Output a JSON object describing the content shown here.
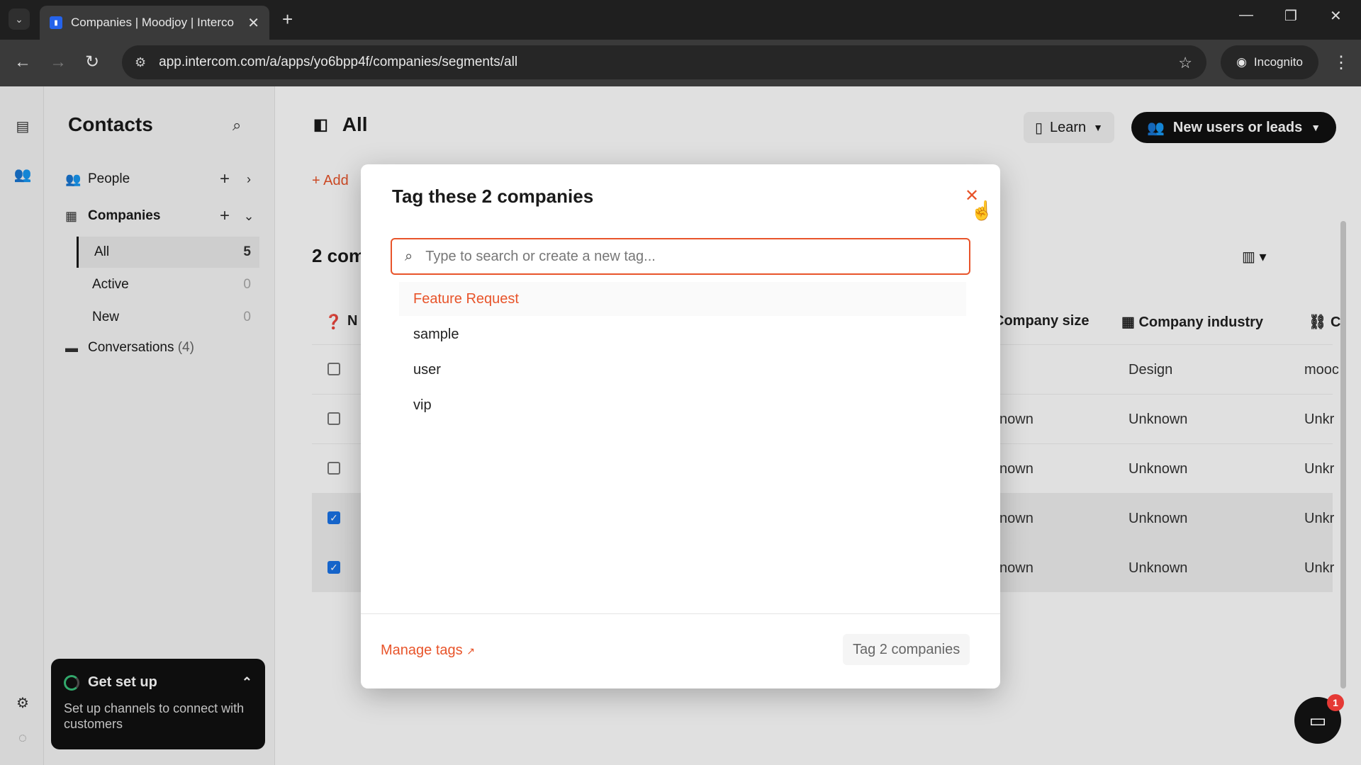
{
  "browser": {
    "tab_title": "Companies | Moodjoy | Interco",
    "url": "app.intercom.com/a/apps/yo6bpp4f/companies/segments/all",
    "incognito_label": "Incognito"
  },
  "sidebar": {
    "title": "Contacts",
    "people_label": "People",
    "companies_label": "Companies",
    "segments": [
      {
        "label": "All",
        "count": "5"
      },
      {
        "label": "Active",
        "count": "0"
      },
      {
        "label": "New",
        "count": "0"
      }
    ],
    "conversations_label": "Conversations",
    "conversations_count": "(4)"
  },
  "setup_card": {
    "title": "Get set up",
    "text": "Set up channels to connect with customers"
  },
  "main": {
    "title": "All",
    "learn_label": "Learn",
    "new_users_label": "New users or leads",
    "add_label": "Add",
    "count_text": "2 com",
    "columns": {
      "name": "N",
      "company_size": "Company size",
      "company_industry": "Company industry",
      "last": "C"
    },
    "rows": [
      {
        "size": "",
        "industry": "Design",
        "last": "mooc",
        "checked": false
      },
      {
        "size": "known",
        "industry": "Unknown",
        "last": "Unkr",
        "checked": false
      },
      {
        "size": "known",
        "industry": "Unknown",
        "last": "Unkr",
        "checked": false
      },
      {
        "size": "known",
        "industry": "Unknown",
        "last": "Unkr",
        "checked": true
      },
      {
        "size": "known",
        "industry": "Unknown",
        "last": "Unkr",
        "checked": true
      }
    ]
  },
  "modal": {
    "title": "Tag these 2 companies",
    "search_placeholder": "Type to search or create a new tag...",
    "tags": [
      "Feature Request",
      "sample",
      "user",
      "vip"
    ],
    "manage_tags_label": "Manage tags",
    "tag_button_label": "Tag 2 companies"
  },
  "messenger": {
    "badge": "1"
  },
  "colors": {
    "accent": "#e8542a",
    "checkbox": "#1a73e8",
    "dark": "#111111"
  }
}
